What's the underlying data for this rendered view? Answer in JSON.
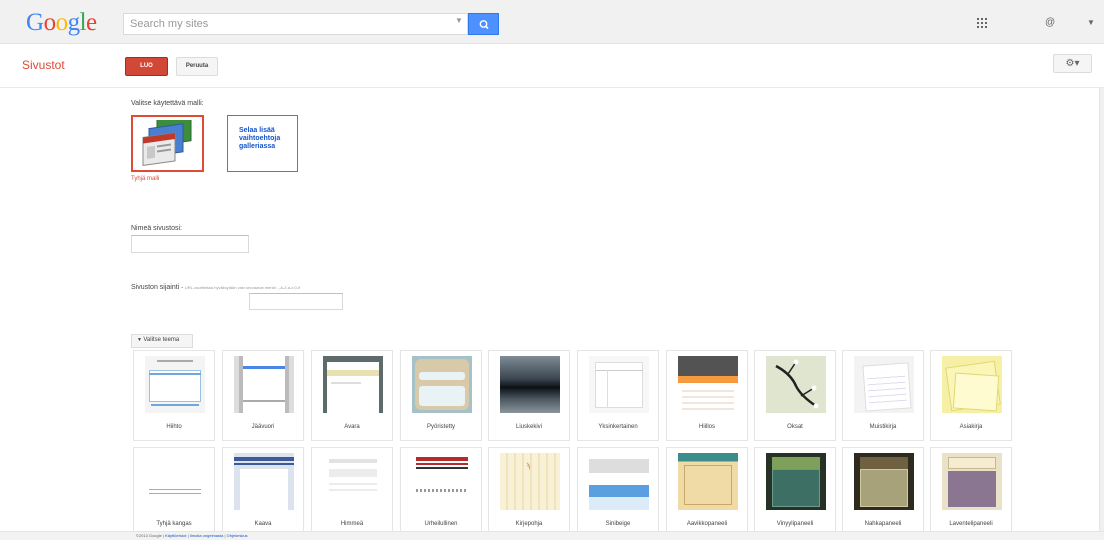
{
  "topbar": {
    "logo": [
      "G",
      "o",
      "o",
      "g",
      "l",
      "e"
    ],
    "search_placeholder": "Search my sites",
    "search_icon": "magnifier-icon",
    "apps_icon": "apps-grid-icon",
    "account_text": "@"
  },
  "subbar": {
    "section_title": "Sivustot",
    "create_label": "LUO",
    "cancel_label": "Peruuta",
    "settings_icon": "gear-icon"
  },
  "template": {
    "prompt": "Valitse käytettävä malli:",
    "blank_caption": "Tyhjä malli",
    "gallery_text": "Selaa lisää vaihtoehtoja galleriassa"
  },
  "name_field": {
    "label": "Nimeä sivustosi:",
    "value": ""
  },
  "location": {
    "label": "Sivuston sijainti",
    "hint": "URL-osoitteissa hyväksytään vain seuraavat merkit: -,A-Z,a-z,0-9",
    "value": ""
  },
  "themes": {
    "toggle_label": "Valitse teema",
    "row1": [
      "Hiihto",
      "Jäävuori",
      "Avara",
      "Pyöristetty",
      "Liuskekivi",
      "Yksinkertainen",
      "Hiillos",
      "Oksat",
      "Muistikirja",
      "Asiakirja"
    ],
    "row2": [
      "Tyhjä kangas",
      "Kaava",
      "Himmeä",
      "Urheilullinen",
      "Kirjepohja",
      "Sinibeige",
      "Aavikkopaneeli",
      "Vinyylipaneeli",
      "Nahkapaneeli",
      "Laventelipaneeli"
    ]
  },
  "footer": {
    "copyright": "©2013 Google",
    "links": [
      "Käyttöehdot",
      "Ilmoita ongelmasta",
      "Ohjekeskus"
    ]
  },
  "colors": {
    "accent": "#dd4b39",
    "search_button": "#4d90fe",
    "link": "#1155cc"
  }
}
